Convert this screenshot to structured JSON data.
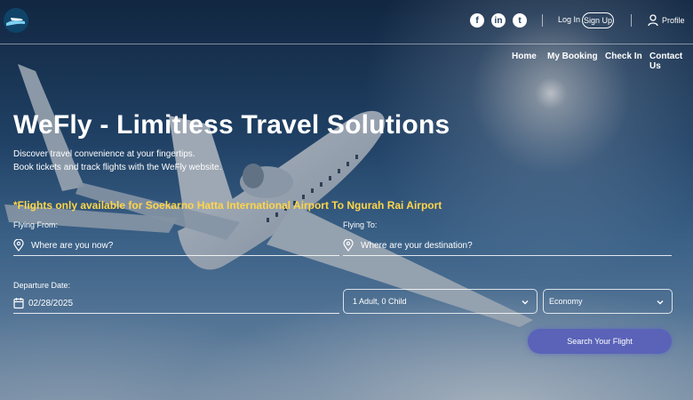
{
  "header": {
    "social": [
      "facebook-icon",
      "linkedin-icon",
      "twitter-icon"
    ],
    "login_label": "Log In",
    "signup_label": "Sign Up",
    "profile_label": "Profile"
  },
  "nav": {
    "items": [
      "Home",
      "My Booking",
      "Check In",
      "Contact Us"
    ]
  },
  "hero": {
    "title": "WeFly - Limitless Travel Solutions",
    "subtitle_line1": "Discover travel convenience at your fingertips.",
    "subtitle_line2": "Book tickets and track flights with the WeFly website.",
    "notice": "*Flights only available for Soekarno Hatta International Airport To Ngurah Rai Airport"
  },
  "form": {
    "from_label": "Flying From:",
    "from_placeholder": "Where are you now?",
    "to_label": "Flying To:",
    "to_placeholder": "Where are your destination?",
    "date_label": "Departure Date:",
    "date_value": "02/28/2025",
    "passengers_value": "1 Adult, 0 Child",
    "class_value": "Economy",
    "search_label": "Search Your Flight"
  },
  "colors": {
    "notice": "#ffd54a",
    "button": "#5a63b8"
  }
}
